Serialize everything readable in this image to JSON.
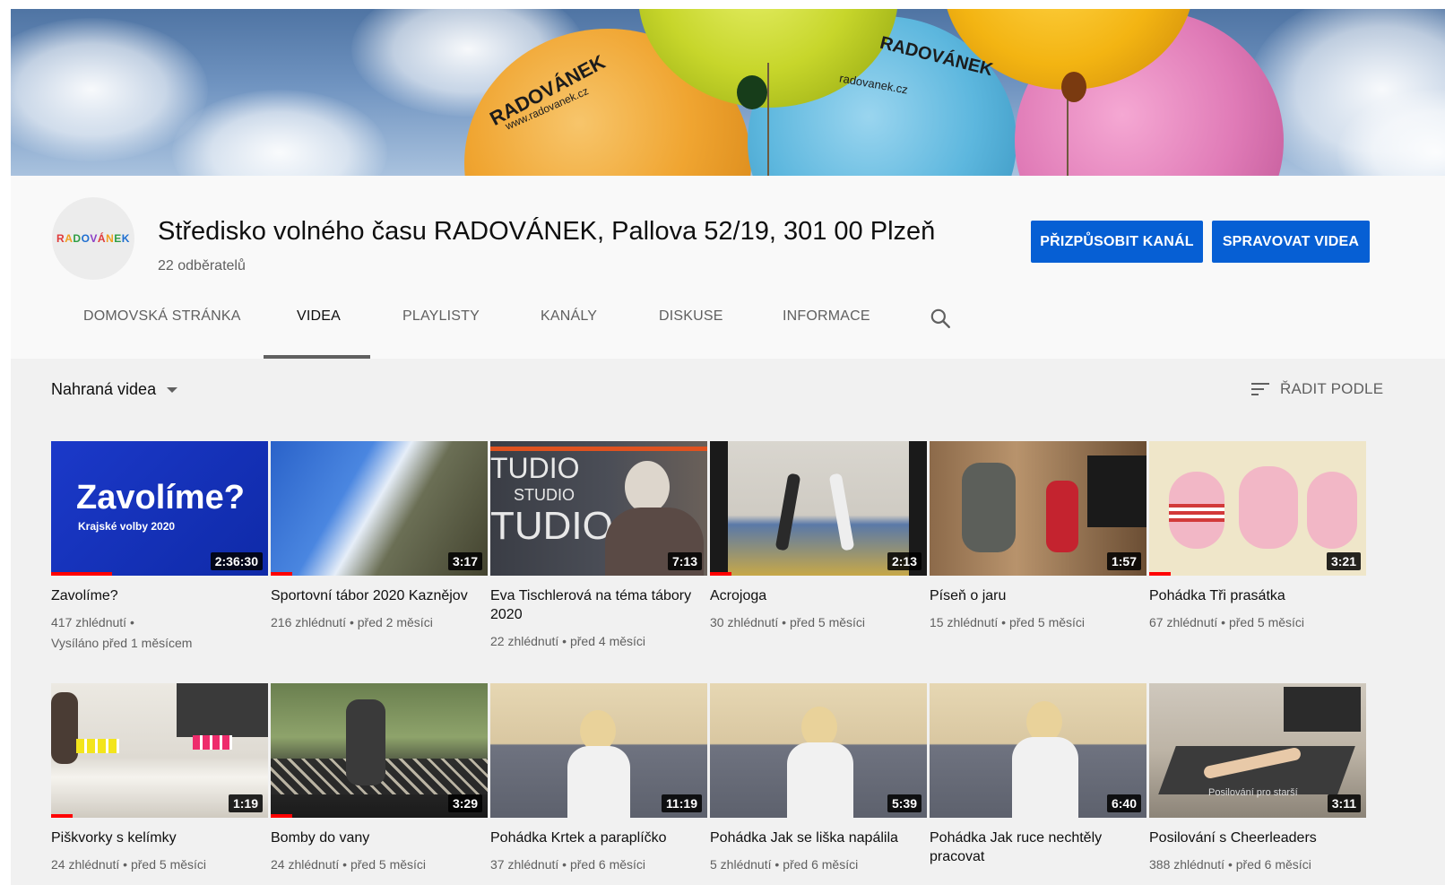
{
  "banner": {
    "balloon_text_1": "RADOVÁNEK",
    "balloon_url_1": "www.radovanek.cz",
    "balloon_text_2": "RADOVÁNEK",
    "balloon_url_2": "radovanek.cz"
  },
  "channel": {
    "avatar_logo": "RADOVÁNEK",
    "title": "Středisko volného času RADOVÁNEK, Pallova 52/19, 301 00 Plzeň",
    "subscribers": "22 odběratelů",
    "customize_label": "PŘIZPŮSOBIT KANÁL",
    "manage_label": "SPRAVOVAT VIDEA"
  },
  "tabs": [
    {
      "label": "DOMOVSKÁ STRÁNKA"
    },
    {
      "label": "VIDEA"
    },
    {
      "label": "PLAYLISTY"
    },
    {
      "label": "KANÁLY"
    },
    {
      "label": "DISKUSE"
    },
    {
      "label": "INFORMACE"
    }
  ],
  "active_tab": "VIDEA",
  "filter": {
    "label": "Nahraná videa"
  },
  "sort": {
    "label": "ŘADIT PODLE"
  },
  "thumb_text": {
    "zavolime_main": "Zavolíme?",
    "zavolime_sub": "Krajské volby 2020",
    "studio_1": "TUDIO",
    "studio_2": "STUDIO",
    "studio_3": "TUDIO",
    "posilovani": "Posilování pro starší"
  },
  "videos": [
    {
      "title": "Zavolíme?",
      "views": "417 zhlédnutí",
      "age": "Vysíláno před 1 měsícem",
      "duration": "2:36:30",
      "watched": 0.28
    },
    {
      "title": "Sportovní tábor 2020 Kaznějov",
      "views": "216 zhlédnutí",
      "age": "před 2 měsíci",
      "duration": "3:17",
      "watched": 0.1
    },
    {
      "title": "Eva Tischlerová na téma tábory 2020",
      "views": "22 zhlédnutí",
      "age": "před 4 měsíci",
      "duration": "7:13",
      "watched": 0
    },
    {
      "title": "Acrojoga",
      "views": "30 zhlédnutí",
      "age": "před 5 měsíci",
      "duration": "2:13",
      "watched": 0.1
    },
    {
      "title": "Píseň o jaru",
      "views": "15 zhlédnutí",
      "age": "před 5 měsíci",
      "duration": "1:57",
      "watched": 0
    },
    {
      "title": "Pohádka Tři prasátka",
      "views": "67 zhlédnutí",
      "age": "před 5 měsíci",
      "duration": "3:21",
      "watched": 0.1
    },
    {
      "title": "Piškvorky s kelímky",
      "views": "24 zhlédnutí",
      "age": "před 5 měsíci",
      "duration": "1:19",
      "watched": 0.1
    },
    {
      "title": "Bomby do vany",
      "views": "24 zhlédnutí",
      "age": "před 5 měsíci",
      "duration": "3:29",
      "watched": 0.1
    },
    {
      "title": "Pohádka Krtek a paraplíčko",
      "views": "37 zhlédnutí",
      "age": "před 6 měsíci",
      "duration": "11:19",
      "watched": 0
    },
    {
      "title": "Pohádka Jak se liška napálila",
      "views": "5 zhlédnutí",
      "age": "před 6 měsíci",
      "duration": "5:39",
      "watched": 0
    },
    {
      "title": "Pohádka Jak ruce nechtěly pracovat",
      "views": "",
      "age": "",
      "duration": "6:40",
      "watched": 0
    },
    {
      "title": "Posilování s Cheerleaders",
      "views": "388 zhlédnutí",
      "age": "před 6 měsíci",
      "duration": "3:11",
      "watched": 0
    }
  ],
  "colors": {
    "primary_button": "#065fd4",
    "progress": "#ff0000",
    "text_secondary": "#606060"
  }
}
